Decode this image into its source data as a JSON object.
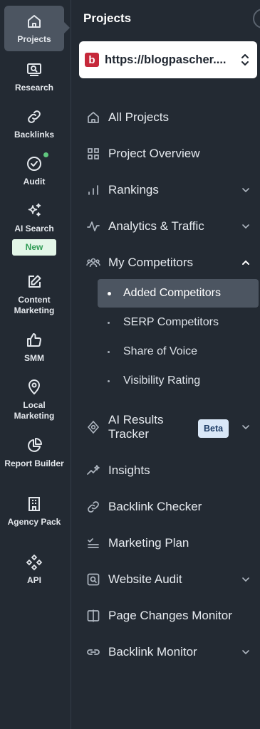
{
  "rail": {
    "items": [
      {
        "label": "Projects"
      },
      {
        "label": "Research"
      },
      {
        "label": "Backlinks"
      },
      {
        "label": "Audit"
      },
      {
        "label": "AI Search",
        "badge": "New"
      },
      {
        "label": "Content Marketing"
      },
      {
        "label": "SMM"
      },
      {
        "label": "Local Marketing"
      },
      {
        "label": "Report Builder"
      },
      {
        "label": "Agency Pack"
      },
      {
        "label": "API"
      }
    ]
  },
  "panel": {
    "title": "Projects",
    "project": {
      "favicon": "b",
      "url": "https://blogpascher...."
    },
    "nav": [
      {
        "label": "All Projects",
        "icon": "home-icon"
      },
      {
        "label": "Project Overview",
        "icon": "grid-icon"
      },
      {
        "label": "Rankings",
        "icon": "bar-chart-icon",
        "expandable": true
      },
      {
        "label": "Analytics & Traffic",
        "icon": "pulse-icon",
        "expandable": true
      },
      {
        "label": "My Competitors",
        "icon": "users-icon",
        "expanded": true,
        "children": [
          {
            "label": "Added Competitors",
            "selected": true
          },
          {
            "label": "SERP Competitors"
          },
          {
            "label": "Share of Voice"
          },
          {
            "label": "Visibility Rating"
          }
        ]
      },
      {
        "label": "AI Results Tracker",
        "icon": "ai-tracker-icon",
        "badge": "Beta",
        "expandable": true
      },
      {
        "label": "Insights",
        "icon": "sparkline-icon"
      },
      {
        "label": "Backlink Checker",
        "icon": "link-icon"
      },
      {
        "label": "Marketing Plan",
        "icon": "checklist-icon"
      },
      {
        "label": "Website Audit",
        "icon": "audit-box-icon",
        "expandable": true
      },
      {
        "label": "Page Changes Monitor",
        "icon": "page-compare-icon"
      },
      {
        "label": "Backlink Monitor",
        "icon": "chain-icon",
        "expandable": true
      }
    ]
  },
  "colors": {
    "background": "#232a33",
    "active": "#4c5561",
    "new_badge": "#e3f6e8",
    "beta_badge": "#d9e7f7",
    "favicon": "#c6283a"
  }
}
